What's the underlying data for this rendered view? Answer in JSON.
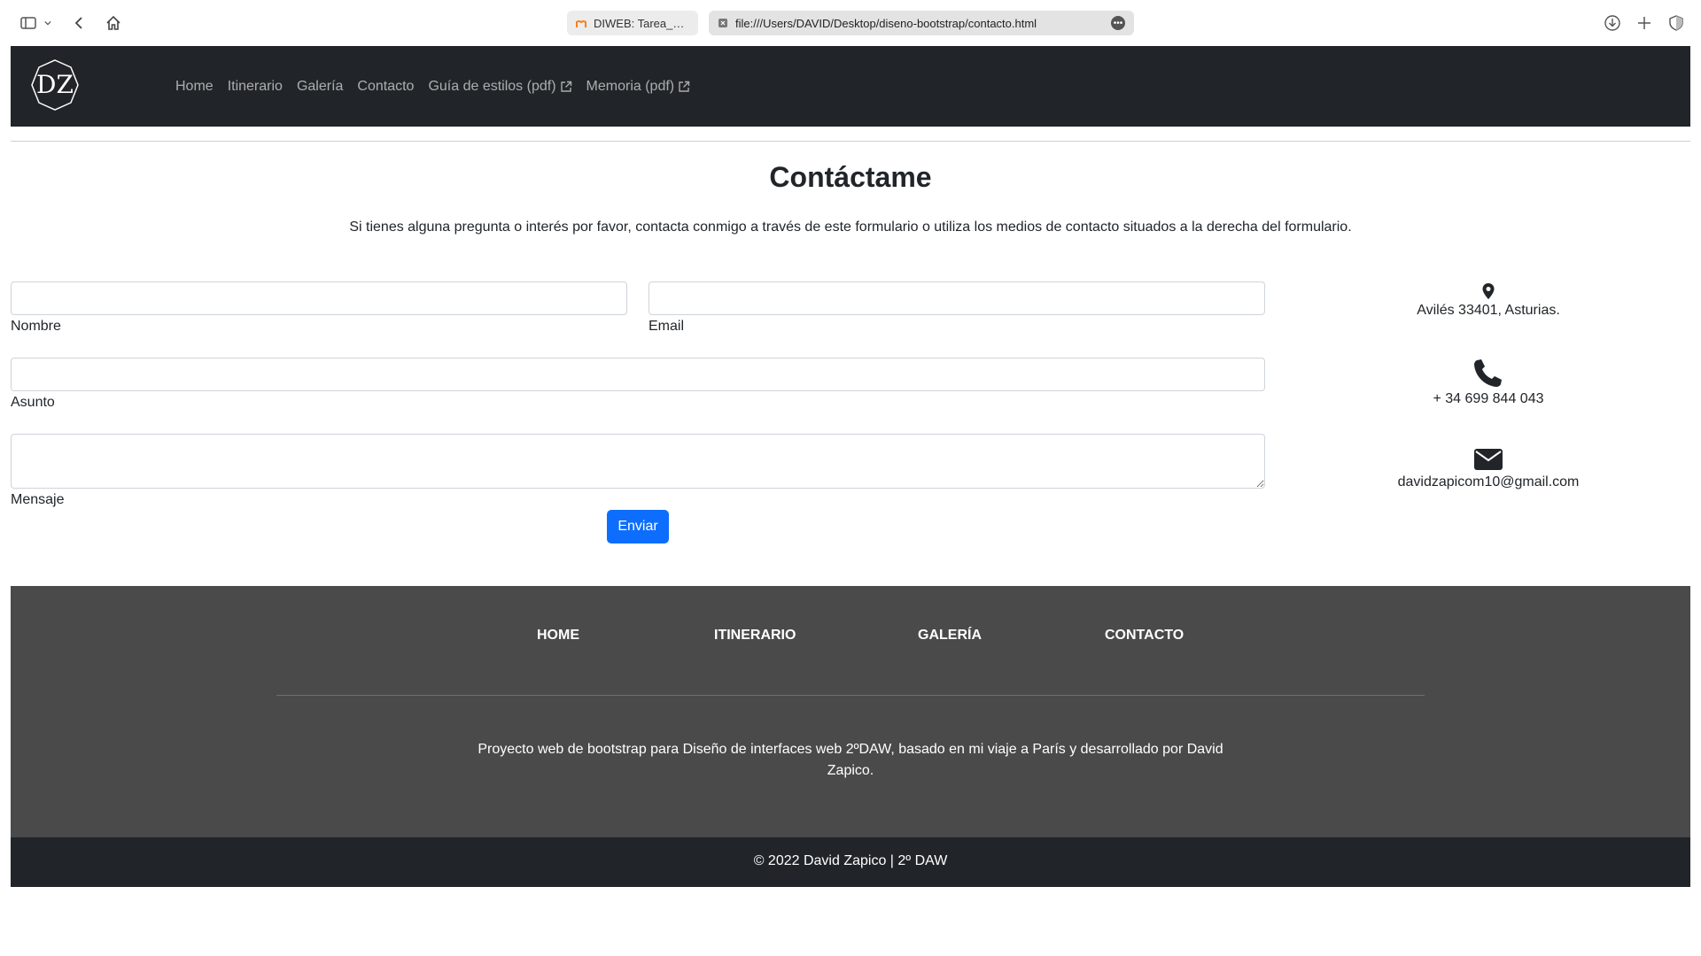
{
  "browser": {
    "tabs": [
      {
        "label": "DIWEB: Tarea_eje...",
        "active": false
      },
      {
        "label": "file:///Users/DAVID/Desktop/diseno-bootstrap/contacto.html",
        "active": true
      }
    ],
    "icons": [
      "sidebar-icon",
      "chevron-down-icon",
      "back-icon",
      "home-icon",
      "download-icon",
      "plus-icon",
      "shield-icon"
    ]
  },
  "navbar": {
    "logo_text": "DZ",
    "links": [
      {
        "label": "Home",
        "external": false
      },
      {
        "label": "Itinerario",
        "external": false
      },
      {
        "label": "Galería",
        "external": false
      },
      {
        "label": "Contacto",
        "external": false
      },
      {
        "label": "Guía de estilos (pdf)",
        "external": true
      },
      {
        "label": "Memoria (pdf)",
        "external": true
      }
    ]
  },
  "main": {
    "title": "Contáctame",
    "intro": "Si tienes alguna pregunta o interés por favor, contacta conmigo a través de este formulario o utiliza los medios de contacto situados a la derecha del formulario.",
    "form": {
      "nombre_label": "Nombre",
      "email_label": "Email",
      "asunto_label": "Asunto",
      "mensaje_label": "Mensaje",
      "submit_label": "Enviar"
    },
    "contact": {
      "address": "Avilés 33401, Asturias.",
      "phone": "+ 34 699 844 043",
      "email": "davidzapicom10@gmail.com"
    }
  },
  "footer": {
    "links": [
      "HOME",
      "ITINERARIO",
      "GALERÍA",
      "CONTACTO"
    ],
    "description": "Proyecto web de bootstrap para Diseño de interfaces web 2ºDAW, basado en mi viaje a París y desarrollado por David Zapico.",
    "copyright": "© 2022 David Zapico | 2º DAW"
  },
  "colors": {
    "navbar_bg": "#212529",
    "footer_bg": "#4a4a4a",
    "button_bg": "#0d6efd"
  }
}
